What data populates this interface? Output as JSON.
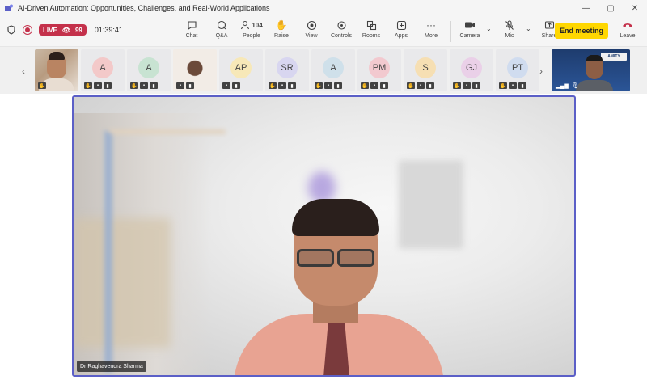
{
  "window": {
    "title": "AI-Driven Automation: Opportunities, Challenges, and Real-World Applications",
    "controls": [
      "—",
      "▢",
      "✕"
    ]
  },
  "status": {
    "live_label": "LIVE",
    "viewers": "99",
    "timer": "01:39:41"
  },
  "toolbar": {
    "actions": [
      {
        "label": "Chat",
        "icon": "chat-icon"
      },
      {
        "label": "Q&A",
        "icon": "qna-icon"
      },
      {
        "label": "People",
        "icon": "people-icon",
        "count": "104"
      },
      {
        "label": "Raise",
        "icon": "raise-hand-icon"
      },
      {
        "label": "View",
        "icon": "view-icon"
      },
      {
        "label": "Controls",
        "icon": "controls-icon"
      },
      {
        "label": "Rooms",
        "icon": "rooms-icon"
      },
      {
        "label": "Apps",
        "icon": "apps-icon"
      },
      {
        "label": "More",
        "icon": "more-icon"
      },
      {
        "label": "Camera",
        "icon": "camera-icon"
      },
      {
        "label": "Mic",
        "icon": "mic-off-icon"
      },
      {
        "label": "Share",
        "icon": "share-icon"
      }
    ],
    "end_meeting": "End meeting",
    "leave": "Leave"
  },
  "participants": [
    {
      "initials": "",
      "type": "photo"
    },
    {
      "initials": "A",
      "color": "#f3c9c9"
    },
    {
      "initials": "A",
      "color": "#c8e3d2"
    },
    {
      "initials": "",
      "type": "photo2"
    },
    {
      "initials": "AP",
      "color": "#f7e8b8"
    },
    {
      "initials": "SR",
      "color": "#d8d6f0"
    },
    {
      "initials": "A",
      "color": "#cfe0ea"
    },
    {
      "initials": "PM",
      "color": "#f2c9cf"
    },
    {
      "initials": "S",
      "color": "#f6dfb3"
    },
    {
      "initials": "GJ",
      "color": "#ead0e8"
    },
    {
      "initials": "PT",
      "color": "#d0dcef"
    }
  ],
  "self_view": {
    "logo": "AMITY"
  },
  "main_speaker": {
    "name": "Dr Raghavendra Sharma"
  },
  "colors": {
    "live": "#c4314b",
    "end_meeting": "#ffd700",
    "active_border": "#5b5fc7"
  }
}
